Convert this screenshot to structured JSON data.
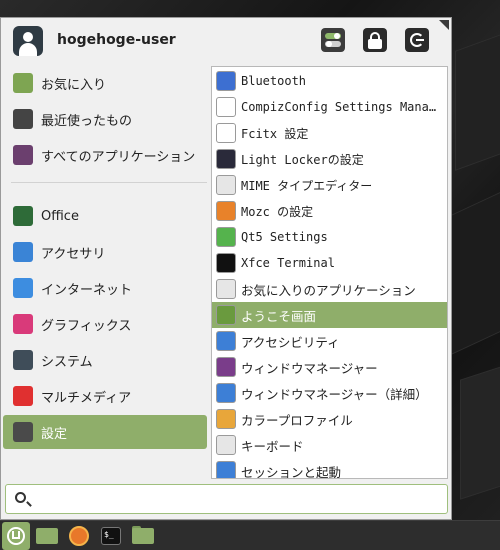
{
  "user": {
    "name": "hogehoge-user"
  },
  "header": {
    "settings_button": "settings-icon",
    "lock_button": "lock-icon",
    "logout_button": "logout-icon"
  },
  "categories": [
    {
      "label": "お気に入り",
      "icon": "star-folder-icon",
      "color": "#7ea552"
    },
    {
      "label": "最近使ったもの",
      "icon": "clock-icon",
      "color": "#444444"
    },
    {
      "label": "すべてのアプリケーション",
      "icon": "grid-icon",
      "color": "#6b3f6e"
    },
    {
      "label": "Office",
      "icon": "office-icon",
      "color": "#2e6b38"
    },
    {
      "label": "アクセサリ",
      "icon": "accessories-icon",
      "color": "#3a84d6"
    },
    {
      "label": "インターネット",
      "icon": "cloud-icon",
      "color": "#3d8de0"
    },
    {
      "label": "グラフィックス",
      "icon": "graphics-icon",
      "color": "#d93a7a"
    },
    {
      "label": "システム",
      "icon": "gear-icon",
      "color": "#3f4d59"
    },
    {
      "label": "マルチメディア",
      "icon": "play-icon",
      "color": "#e03030"
    },
    {
      "label": "設定",
      "icon": "settings-icon",
      "color": "#4a4a4a",
      "active": true
    }
  ],
  "apps": [
    {
      "label": "Bluetooth",
      "icon": "bluetooth-icon",
      "color": "#3d6fd1",
      "mono": true
    },
    {
      "label": "CompizConfig Settings Manager",
      "icon": "cursor-icon",
      "color": "#ffffff",
      "mono": true
    },
    {
      "label": "Fcitx 設定",
      "icon": "penguin-icon",
      "color": "#ffffff",
      "mono": true
    },
    {
      "label": "Light Lockerの設定",
      "icon": "moon-icon",
      "color": "#2a2a3a",
      "mono": true
    },
    {
      "label": "MIME タイプエディター",
      "icon": "gear-icon",
      "color": "#e6e6e6",
      "mono": true
    },
    {
      "label": "Mozc の設定",
      "icon": "mozc-icon",
      "color": "#e8822a",
      "mono": true
    },
    {
      "label": "Qt5 Settings",
      "icon": "qt-icon",
      "color": "#55b34d",
      "mono": true
    },
    {
      "label": "Xfce Terminal",
      "icon": "terminal-icon",
      "color": "#111111",
      "mono": true
    },
    {
      "label": "お気に入りのアプリケーション",
      "icon": "gear-icon",
      "color": "#e6e6e6",
      "mono": false
    },
    {
      "label": "ようこそ画面",
      "icon": "mint-icon",
      "color": "#6a9a3e",
      "mono": false,
      "active": true
    },
    {
      "label": "アクセシビリティ",
      "icon": "accessibility-icon",
      "color": "#3d7fd6",
      "mono": false
    },
    {
      "label": "ウィンドウマネージャー",
      "icon": "window-manager-icon",
      "color": "#7a3d8a",
      "mono": false
    },
    {
      "label": "ウィンドウマネージャー（詳細）",
      "icon": "window-tweaks-icon",
      "color": "#3d7fd6",
      "mono": false
    },
    {
      "label": "カラープロファイル",
      "icon": "color-profile-icon",
      "color": "#e8a63a",
      "mono": false
    },
    {
      "label": "キーボード",
      "icon": "keyboard-icon",
      "color": "#e6e6e6",
      "mono": false
    },
    {
      "label": "セッションと起動",
      "icon": "session-icon",
      "color": "#3d7fd6",
      "mono": false
    }
  ],
  "search": {
    "value": "",
    "placeholder": ""
  },
  "taskbar": [
    {
      "icon": "menu-icon"
    },
    {
      "icon": "show-desktop-icon"
    },
    {
      "icon": "firefox-icon"
    },
    {
      "icon": "terminal-icon"
    },
    {
      "icon": "file-manager-icon"
    }
  ],
  "accent": "#8fae6a"
}
